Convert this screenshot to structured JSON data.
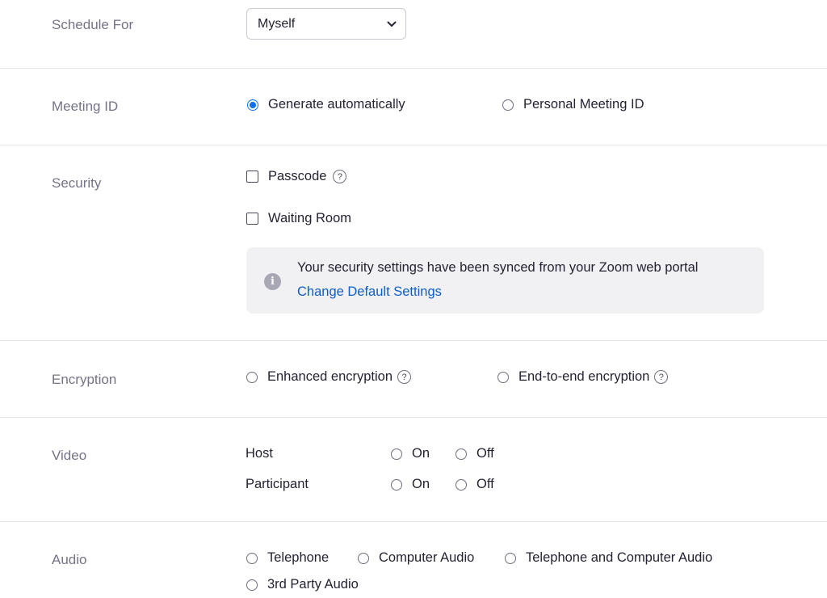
{
  "schedule_for": {
    "label": "Schedule For",
    "selected": "Myself"
  },
  "meeting_id": {
    "label": "Meeting ID",
    "options": [
      "Generate automatically",
      "Personal Meeting ID"
    ],
    "selected": "Generate automatically"
  },
  "security": {
    "label": "Security",
    "passcode_label": "Passcode",
    "passcode_checked": false,
    "waiting_room_label": "Waiting Room",
    "waiting_room_checked": false,
    "info_text": "Your security settings have been synced from your Zoom web portal",
    "info_link": "Change Default Settings",
    "help_glyph": "?",
    "info_glyph": "i"
  },
  "encryption": {
    "label": "Encryption",
    "options": [
      "Enhanced encryption",
      "End-to-end encryption"
    ]
  },
  "video": {
    "label": "Video",
    "host_label": "Host",
    "participant_label": "Participant",
    "on_label": "On",
    "off_label": "Off"
  },
  "audio": {
    "label": "Audio",
    "options": [
      "Telephone",
      "Computer Audio",
      "Telephone and Computer Audio",
      "3rd Party Audio"
    ]
  },
  "colors": {
    "accent": "#0e72ed",
    "link": "#0e5ec5",
    "label_gray": "#747487",
    "divider": "#e4e4ea",
    "info_bg": "#f1f1f4"
  },
  "icons": {
    "select_arrow": "chevron-down-icon",
    "help": "question-circle-icon",
    "info": "info-circle-icon"
  }
}
